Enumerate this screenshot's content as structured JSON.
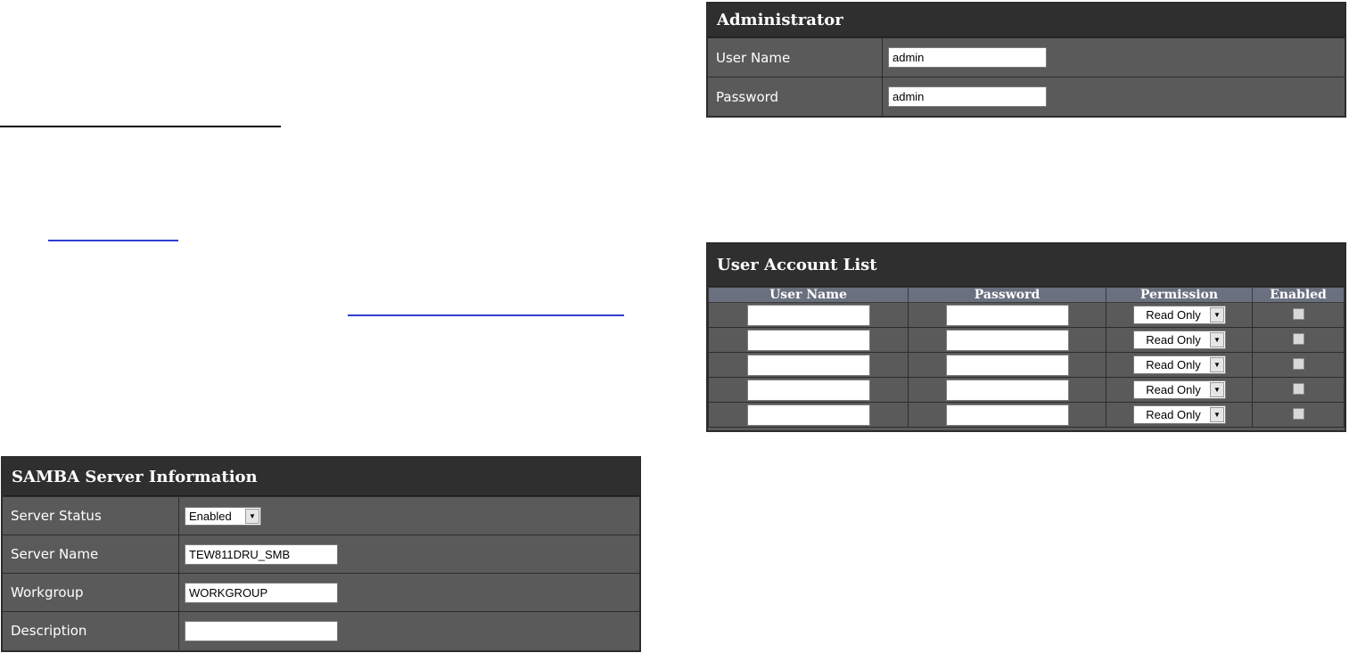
{
  "administrator": {
    "title": "Administrator",
    "username_label": "User Name",
    "username_value": "admin",
    "password_label": "Password",
    "password_value": "admin"
  },
  "user_account_list": {
    "title": "User Account List",
    "columns": [
      "User Name",
      "Password",
      "Permission",
      "Enabled"
    ],
    "rows": [
      {
        "username": "",
        "password": "",
        "permission": "Read Only",
        "enabled": false
      },
      {
        "username": "",
        "password": "",
        "permission": "Read Only",
        "enabled": false
      },
      {
        "username": "",
        "password": "",
        "permission": "Read Only",
        "enabled": false
      },
      {
        "username": "",
        "password": "",
        "permission": "Read Only",
        "enabled": false
      },
      {
        "username": "",
        "password": "",
        "permission": "Read Only",
        "enabled": false
      }
    ]
  },
  "samba": {
    "title": "SAMBA Server Information",
    "server_status_label": "Server Status",
    "server_status_value": "Enabled",
    "server_name_label": "Server Name",
    "server_name_value": "TEW811DRU_SMB",
    "workgroup_label": "Workgroup",
    "workgroup_value": "WORKGROUP",
    "description_label": "Description",
    "description_value": ""
  },
  "colors": {
    "panel_bg": "#5a5a5a",
    "header_bg": "#2f2f2f",
    "table_header_bg": "#6b7080",
    "link": "#2f3fd0"
  }
}
